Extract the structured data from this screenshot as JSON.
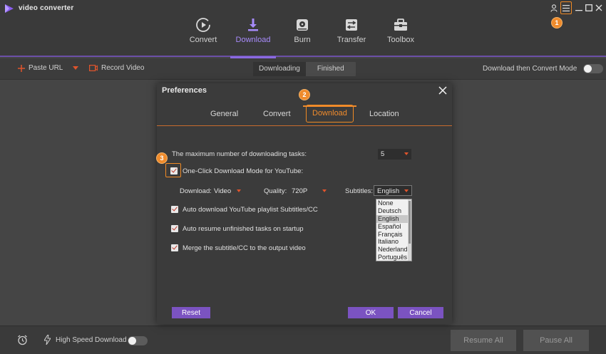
{
  "app": {
    "title": "video converter"
  },
  "nav": [
    {
      "label": "Convert",
      "icon": "convert-icon"
    },
    {
      "label": "Download",
      "icon": "download-icon"
    },
    {
      "label": "Burn",
      "icon": "burn-icon"
    },
    {
      "label": "Transfer",
      "icon": "transfer-icon"
    },
    {
      "label": "Toolbox",
      "icon": "toolbox-icon"
    }
  ],
  "toolbar": {
    "paste_url": "Paste URL",
    "record_video": "Record Video",
    "tab_downloading": "Downloading",
    "tab_finished": "Finished",
    "convert_mode": "Download then Convert Mode"
  },
  "bottombar": {
    "high_speed": "High Speed Download",
    "resume_all": "Resume All",
    "pause_all": "Pause All"
  },
  "dialog": {
    "title": "Preferences",
    "tabs": [
      "General",
      "Convert",
      "Download",
      "Location"
    ],
    "max_tasks_label": "The maximum number of downloading tasks:",
    "max_tasks_value": "5",
    "one_click_label": "One-Click Download Mode for YouTube:",
    "download_label": "Download:",
    "download_value": "Video",
    "quality_label": "Quality:",
    "quality_value": "720P",
    "subtitles_label": "Subtitles:",
    "subtitles_value": "English",
    "subtitle_options": [
      "None",
      "Deutsch",
      "English",
      "Español",
      "Français",
      "Italiano",
      "Nederland",
      "Português"
    ],
    "opt_auto_subtitles": "Auto download YouTube playlist Subtitles/CC",
    "opt_auto_resume": "Auto resume unfinished tasks on startup",
    "opt_merge": "Merge the subtitle/CC to the output video",
    "reset": "Reset",
    "ok": "OK",
    "cancel": "Cancel"
  },
  "badges": {
    "b1": "1",
    "b2": "2",
    "b3": "3"
  },
  "colors": {
    "accent": "#7b53c1",
    "highlight": "#ef8b2c",
    "nav_active": "#a78bfa"
  }
}
